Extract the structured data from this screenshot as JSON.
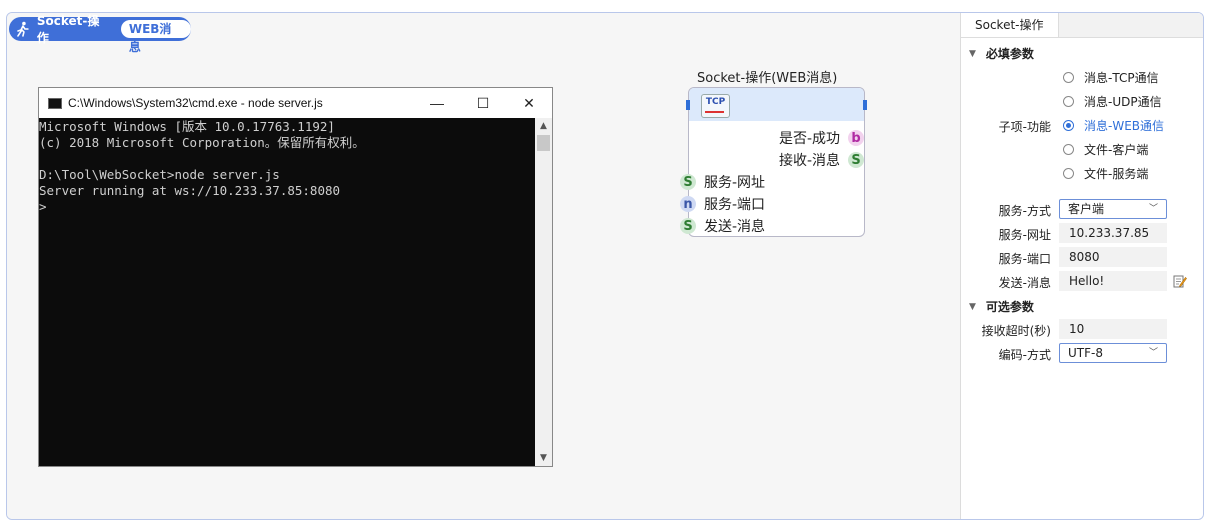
{
  "header": {
    "title": "Socket-操作",
    "badge": "WEB消息"
  },
  "cmd": {
    "title": "C:\\Windows\\System32\\cmd.exe - node  server.js",
    "controls": {
      "minimize": "—",
      "maximize": "☐",
      "close": "✕"
    },
    "lines": [
      "Microsoft Windows [版本 10.0.17763.1192]",
      "(c) 2018 Microsoft Corporation。保留所有权利。",
      "",
      "D:\\Tool\\WebSocket>node server.js",
      "Server running at ws://10.233.37.85:8080",
      ">"
    ]
  },
  "node": {
    "title": "Socket-操作(WEB消息)",
    "icon_label": "TCP",
    "outputs": [
      {
        "label": "是否-成功",
        "pin": "b"
      },
      {
        "label": "接收-消息",
        "pin": "S"
      }
    ],
    "inputs": [
      {
        "label": "服务-网址",
        "pin": "S"
      },
      {
        "label": "服务-端口",
        "pin": "n"
      },
      {
        "label": "发送-消息",
        "pin": "S"
      }
    ]
  },
  "props": {
    "tab": "Socket-操作",
    "required_title": "必填参数",
    "optional_title": "可选参数",
    "function_label": "子项-功能",
    "options": [
      {
        "label": "消息-TCP通信",
        "selected": false
      },
      {
        "label": "消息-UDP通信",
        "selected": false
      },
      {
        "label": "消息-WEB通信",
        "selected": true
      },
      {
        "label": "文件-客户端",
        "selected": false
      },
      {
        "label": "文件-服务端",
        "selected": false
      }
    ],
    "service_mode": {
      "label": "服务-方式",
      "value": "客户端"
    },
    "service_url": {
      "label": "服务-网址",
      "value": "10.233.37.85"
    },
    "service_port": {
      "label": "服务-端口",
      "value": "8080"
    },
    "send_message": {
      "label": "发送-消息",
      "value": "Hello!"
    },
    "recv_timeout": {
      "label": "接收超时(秒)",
      "value": "10"
    },
    "encoding": {
      "label": "编码-方式",
      "value": "UTF-8"
    }
  }
}
